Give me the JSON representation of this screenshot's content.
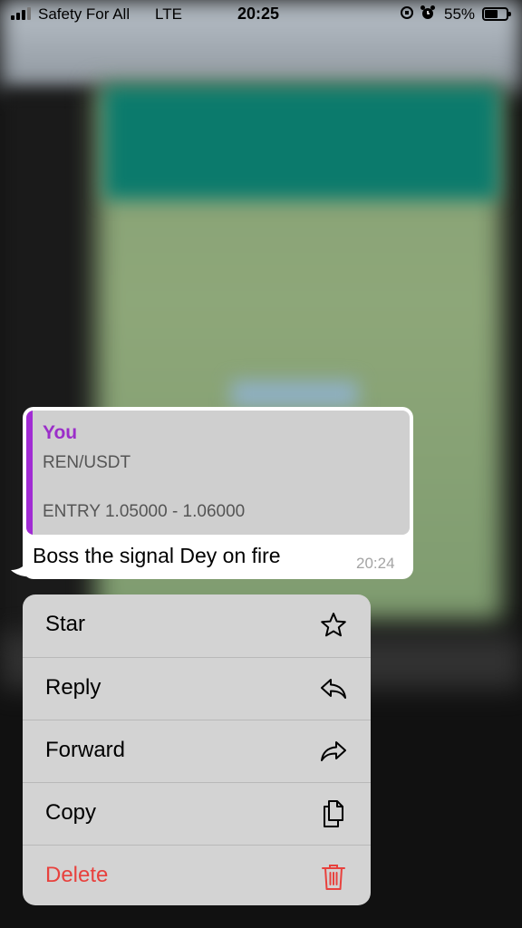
{
  "status_bar": {
    "carrier": "Safety For All",
    "network": "LTE",
    "time": "20:25",
    "battery_percent": "55%",
    "signal_bars": 3,
    "battery_level": 0.55
  },
  "message": {
    "quote": {
      "author": "You",
      "line1": "REN/USDT",
      "line2": "ENTRY 1.05000 - 1.06000"
    },
    "text": "Boss the signal Dey on fire",
    "time": "20:24"
  },
  "menu": {
    "items": [
      {
        "label": "Star",
        "icon": "star-icon"
      },
      {
        "label": "Reply",
        "icon": "reply-icon"
      },
      {
        "label": "Forward",
        "icon": "forward-icon"
      },
      {
        "label": "Copy",
        "icon": "copy-icon"
      },
      {
        "label": "Delete",
        "icon": "trash-icon"
      }
    ]
  },
  "colors": {
    "quote_accent": "#a12bd4",
    "quote_author": "#9b2ec9",
    "danger": "#e8413d",
    "menu_bg": "#d3d3d3",
    "bubble_bg": "#ffffff"
  }
}
